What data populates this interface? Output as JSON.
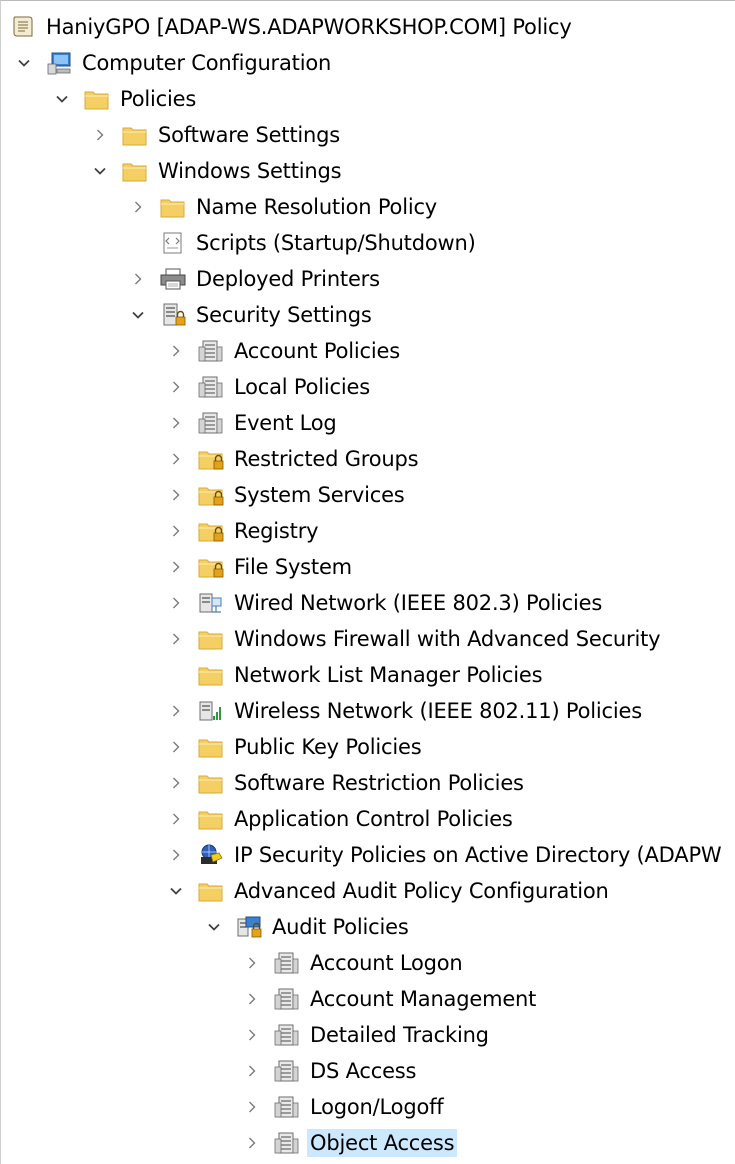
{
  "tree": [
    {
      "label": "HaniyGPO [ADAP-WS.ADAPWORKSHOP.COM] Policy",
      "level": 0,
      "expander": "none",
      "icon": "scroll-icon"
    },
    {
      "label": "Computer Configuration",
      "level": 0,
      "expander": "expanded",
      "icon": "computer-icon"
    },
    {
      "label": "Policies",
      "level": 1,
      "expander": "expanded",
      "icon": "folder-icon"
    },
    {
      "label": "Software Settings",
      "level": 2,
      "expander": "collapsed",
      "icon": "folder-icon"
    },
    {
      "label": "Windows Settings",
      "level": 2,
      "expander": "expanded",
      "icon": "folder-icon"
    },
    {
      "label": "Name Resolution Policy",
      "level": 3,
      "expander": "collapsed",
      "icon": "folder-icon"
    },
    {
      "label": "Scripts (Startup/Shutdown)",
      "level": 3,
      "expander": "none",
      "icon": "script-icon"
    },
    {
      "label": "Deployed Printers",
      "level": 3,
      "expander": "collapsed",
      "icon": "printer-icon"
    },
    {
      "label": "Security Settings",
      "level": 3,
      "expander": "expanded",
      "icon": "server-lock-icon"
    },
    {
      "label": "Account Policies",
      "level": 4,
      "expander": "collapsed",
      "icon": "server-icon"
    },
    {
      "label": "Local Policies",
      "level": 4,
      "expander": "collapsed",
      "icon": "server-icon"
    },
    {
      "label": "Event Log",
      "level": 4,
      "expander": "collapsed",
      "icon": "server-icon"
    },
    {
      "label": "Restricted Groups",
      "level": 4,
      "expander": "collapsed",
      "icon": "folder-lock-icon"
    },
    {
      "label": "System Services",
      "level": 4,
      "expander": "collapsed",
      "icon": "folder-lock-icon"
    },
    {
      "label": "Registry",
      "level": 4,
      "expander": "collapsed",
      "icon": "folder-lock-icon"
    },
    {
      "label": "File System",
      "level": 4,
      "expander": "collapsed",
      "icon": "folder-lock-icon"
    },
    {
      "label": "Wired Network (IEEE 802.3) Policies",
      "level": 4,
      "expander": "collapsed",
      "icon": "network-icon"
    },
    {
      "label": "Windows Firewall with Advanced Security",
      "level": 4,
      "expander": "collapsed",
      "icon": "folder-icon"
    },
    {
      "label": "Network List Manager Policies",
      "level": 4,
      "expander": "none",
      "icon": "folder-icon"
    },
    {
      "label": "Wireless Network (IEEE 802.11) Policies",
      "level": 4,
      "expander": "collapsed",
      "icon": "wireless-icon"
    },
    {
      "label": "Public Key Policies",
      "level": 4,
      "expander": "collapsed",
      "icon": "folder-icon"
    },
    {
      "label": "Software Restriction Policies",
      "level": 4,
      "expander": "collapsed",
      "icon": "folder-icon"
    },
    {
      "label": "Application Control Policies",
      "level": 4,
      "expander": "collapsed",
      "icon": "folder-icon"
    },
    {
      "label": "IP Security Policies on Active Directory (ADAPW",
      "level": 4,
      "expander": "collapsed",
      "icon": "ip-security-icon"
    },
    {
      "label": "Advanced Audit Policy Configuration",
      "level": 4,
      "expander": "expanded",
      "icon": "folder-icon"
    },
    {
      "label": "Audit Policies",
      "level": 5,
      "expander": "expanded",
      "icon": "audit-icon"
    },
    {
      "label": "Account Logon",
      "level": 6,
      "expander": "collapsed",
      "icon": "server-icon"
    },
    {
      "label": "Account Management",
      "level": 6,
      "expander": "collapsed",
      "icon": "server-icon"
    },
    {
      "label": "Detailed Tracking",
      "level": 6,
      "expander": "collapsed",
      "icon": "server-icon"
    },
    {
      "label": "DS Access",
      "level": 6,
      "expander": "collapsed",
      "icon": "server-icon"
    },
    {
      "label": "Logon/Logoff",
      "level": 6,
      "expander": "collapsed",
      "icon": "server-icon"
    },
    {
      "label": "Object Access",
      "level": 6,
      "expander": "collapsed",
      "icon": "server-icon",
      "selected": true
    }
  ],
  "colors": {
    "selection": "#cce8ff",
    "folder": "#f4cf63",
    "folder_dark": "#d9a936",
    "chevron": "#555555",
    "lock": "#e0a000"
  }
}
